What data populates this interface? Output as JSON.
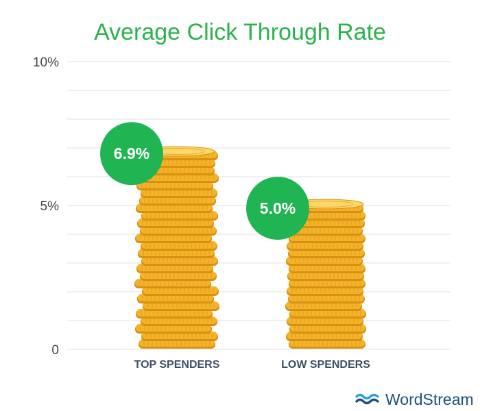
{
  "chart_data": {
    "type": "bar",
    "title": "Average Click Through Rate",
    "categories": [
      "TOP SPENDERS",
      "LOW SPENDERS"
    ],
    "values": [
      6.9,
      5.0
    ],
    "data_labels": [
      "6.9%",
      "5.0%"
    ],
    "yticks": [
      0,
      5,
      10
    ],
    "ytick_labels": [
      "0",
      "5%",
      "10%"
    ],
    "ylim": [
      0,
      10
    ],
    "grid": true,
    "colors": {
      "title": "#2bb24c",
      "bubble": "#20b552",
      "coin": "#f4b42a",
      "coin_dark": "#d88f12",
      "coin_light": "#fcd76a",
      "grid": "#e6e6e6",
      "axis_text": "#444444",
      "category_text": "#3d4f66",
      "brand": "#1f4f7e",
      "brand_icon": "#2a9fd8"
    }
  },
  "brand": {
    "name": "WordStream",
    "icon": "wave-logo-icon"
  }
}
